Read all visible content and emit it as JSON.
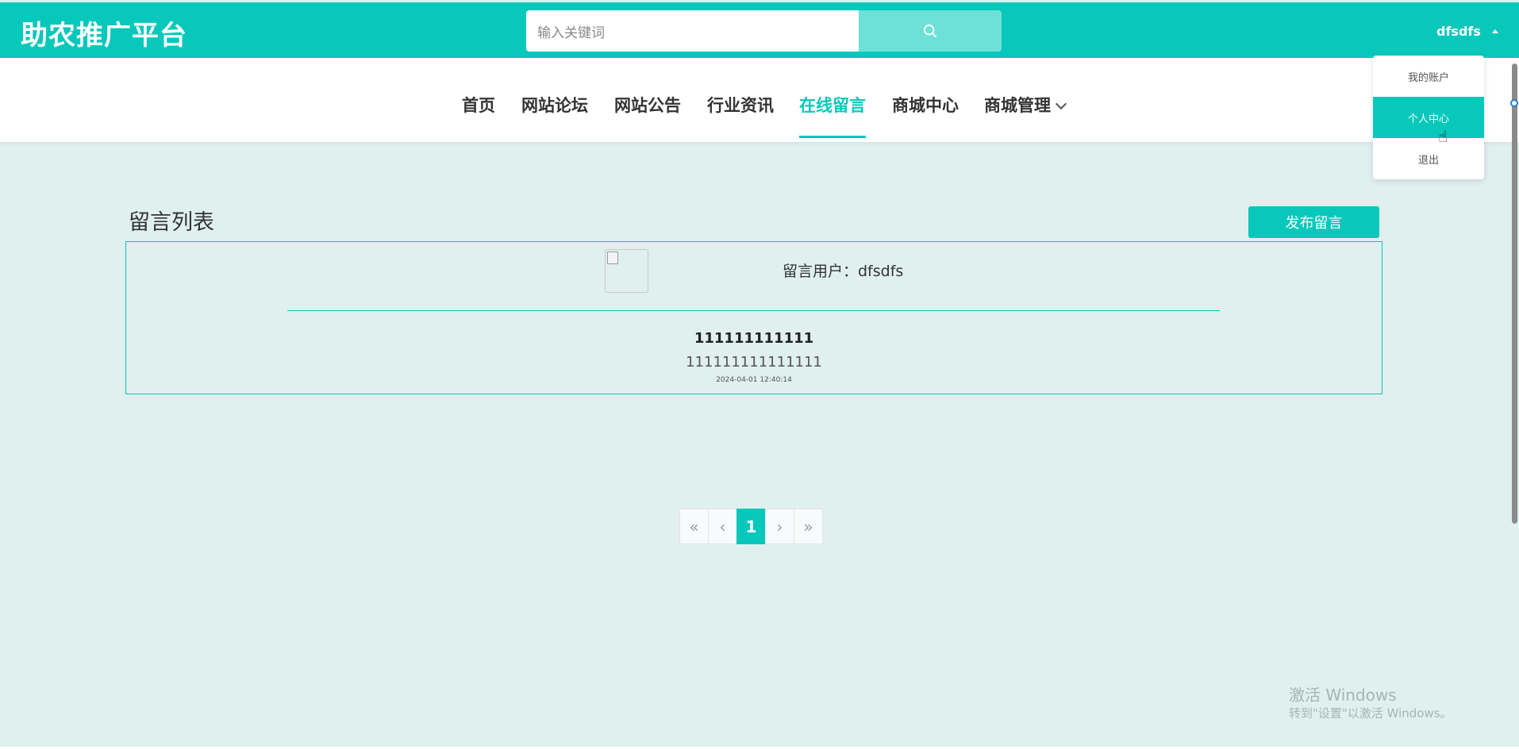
{
  "app": {
    "logo": "助农推广平台"
  },
  "search": {
    "placeholder": "输入关键词"
  },
  "user": {
    "name": "dfsdfs"
  },
  "dropdown": {
    "items": [
      "我的账户",
      "个人中心",
      "退出"
    ],
    "active_index": 1
  },
  "nav": {
    "items": [
      "首页",
      "网站论坛",
      "网站公告",
      "行业资讯",
      "在线留言",
      "商城中心",
      "商城管理"
    ],
    "active": "在线留言"
  },
  "main": {
    "section_title": "留言列表",
    "publish_button": "发布留言",
    "message": {
      "user_label": "留言用户：dfsdfs",
      "title": "111111111111",
      "content": "111111111111111",
      "time": "2024-04-01 12:40:14"
    }
  },
  "pagination": {
    "first": "«",
    "prev": "‹",
    "current": "1",
    "next": "›",
    "last": "»"
  },
  "watermark": {
    "line1": "激活 Windows",
    "line2": "转到\"设置\"以激活 Windows。"
  },
  "colors": {
    "primary": "#08c8bb",
    "background": "#e0f0ef"
  }
}
